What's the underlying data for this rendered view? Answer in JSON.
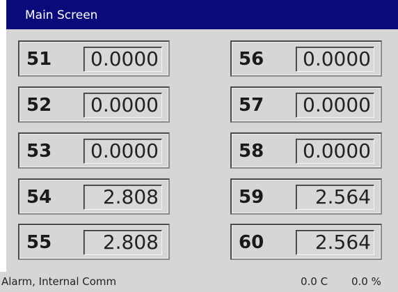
{
  "title": "Main Screen",
  "colors": {
    "titlebar": "#0a0a7a",
    "background": "#d6d6d6"
  },
  "channels": [
    {
      "label": "51",
      "value": "0.0000"
    },
    {
      "label": "52",
      "value": "0.0000"
    },
    {
      "label": "53",
      "value": "0.0000"
    },
    {
      "label": "54",
      "value": "2.808"
    },
    {
      "label": "55",
      "value": "2.808"
    },
    {
      "label": "56",
      "value": "0.0000"
    },
    {
      "label": "57",
      "value": "0.0000"
    },
    {
      "label": "58",
      "value": "0.0000"
    },
    {
      "label": "59",
      "value": "2.564"
    },
    {
      "label": "60",
      "value": "2.564"
    }
  ],
  "status": {
    "alarm": "Alarm, Internal Comm",
    "temperature": "0.0 C",
    "percent": "0.0 %"
  }
}
